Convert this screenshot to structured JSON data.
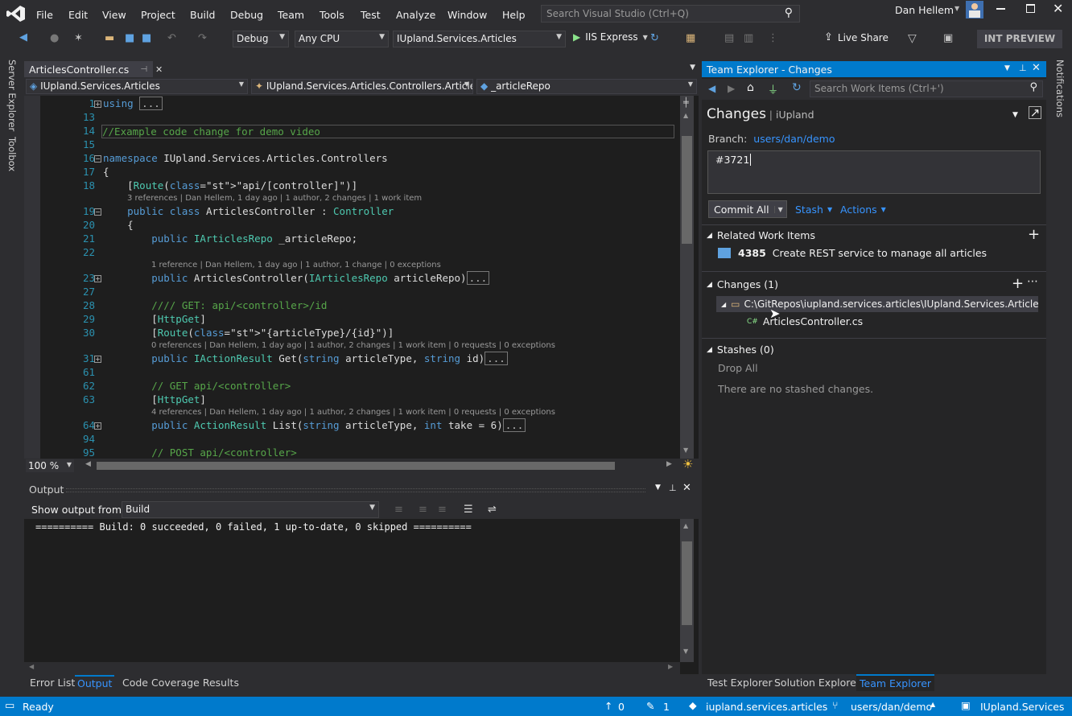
{
  "menu": [
    "File",
    "Edit",
    "View",
    "Project",
    "Build",
    "Debug",
    "Team",
    "Tools",
    "Test",
    "Analyze",
    "Window",
    "Help"
  ],
  "quick_launch": {
    "placeholder": "Search Visual Studio (Ctrl+Q)"
  },
  "user": {
    "name": "Dan Hellem"
  },
  "toolbar": {
    "config": "Debug",
    "platform": "Any CPU",
    "startup_project": "IUpland.Services.Articles",
    "run_target": "IIS Express",
    "live_share": "Live Share",
    "preview_badge": "INT PREVIEW"
  },
  "side_left": [
    "Server Explorer",
    "Toolbox"
  ],
  "side_right": [
    "Notifications"
  ],
  "editor": {
    "tab": "ArticlesController.cs",
    "nav": {
      "project": "IUpland.Services.Articles",
      "class": "IUpland.Services.Articles.Controllers.Article",
      "member": "_articleRepo"
    },
    "zoom": "100 %",
    "lines": [
      {
        "n": "1",
        "text": "using ",
        "collapsed": "..."
      },
      {
        "n": "13",
        "text": ""
      },
      {
        "n": "14",
        "text": "//Example code change for demo video"
      },
      {
        "n": "15",
        "text": ""
      },
      {
        "n": "16",
        "text": "namespace IUpland.Services.Articles.Controllers"
      },
      {
        "n": "17",
        "text": "{"
      },
      {
        "n": "18",
        "text": "    [Route(\"api/[controller]\")]"
      },
      {
        "n": "19",
        "text": "    public class ArticlesController : Controller",
        "lens": "3 references | Dan Hellem, 1 day ago | 1 author, 2 changes | 1 work item"
      },
      {
        "n": "20",
        "text": "    {"
      },
      {
        "n": "21",
        "text": "        public IArticlesRepo _articleRepo;"
      },
      {
        "n": "22",
        "text": ""
      },
      {
        "n": "23",
        "text": "        public ArticlesController(IArticlesRepo articleRepo)",
        "collapsed": "...",
        "lens": "1 reference | Dan Hellem, 1 day ago | 1 author, 1 change | 0 exceptions"
      },
      {
        "n": "27",
        "text": ""
      },
      {
        "n": "28",
        "text": "        //// GET: api/<controller>/id"
      },
      {
        "n": "29",
        "text": "        [HttpGet]"
      },
      {
        "n": "30",
        "text": "        [Route(\"{articleType}/{id}\")]"
      },
      {
        "n": "31",
        "text": "        public IActionResult Get(string articleType, string id)",
        "collapsed": "...",
        "lens": "0 references | Dan Hellem, 1 day ago | 1 author, 2 changes | 1 work item | 0 requests | 0 exceptions"
      },
      {
        "n": "61",
        "text": ""
      },
      {
        "n": "62",
        "text": "        // GET api/<controller>"
      },
      {
        "n": "63",
        "text": "        [HttpGet]"
      },
      {
        "n": "64",
        "text": "        public ActionResult List(string articleType, int take = 6)",
        "collapsed": "...",
        "lens": "4 references | Dan Hellem, 1 day ago | 1 author, 2 changes | 1 work item | 0 requests | 0 exceptions"
      },
      {
        "n": "94",
        "text": ""
      },
      {
        "n": "95",
        "text": "        // POST api/<controller>"
      }
    ]
  },
  "output": {
    "title": "Output",
    "show_from_label": "Show output from:",
    "source": "Build",
    "text": "========== Build: 0 succeeded, 0 failed, 1 up-to-date, 0 skipped =========="
  },
  "bottom_tabs": [
    "Error List",
    "Output",
    "Code Coverage Results"
  ],
  "team_explorer": {
    "title": "Team Explorer - Changes",
    "search_placeholder": "Search Work Items (Ctrl+')",
    "page": "Changes",
    "repo": "iUpland",
    "branch_label": "Branch:",
    "branch": "users/dan/demo",
    "commit_message": "#3721",
    "commit_button": "Commit All",
    "stash": "Stash",
    "actions": "Actions",
    "related_title": "Related Work Items",
    "work_item": {
      "id": "4385",
      "title": "Create REST service to manage all articles"
    },
    "changes_title": "Changes (1)",
    "folder": "C:\\GitRepos\\iupland.services.articles\\IUpland.Services.Articles\\...",
    "file": "ArticlesController.cs",
    "stashes_title": "Stashes (0)",
    "drop_all": "Drop All",
    "no_stash": "There are no stashed changes.",
    "tabs": [
      "Test Explorer",
      "Solution Explorer",
      "Team Explorer"
    ]
  },
  "status": {
    "ready": "Ready",
    "up": "0",
    "pending": "1",
    "repo": "iupland.services.articles",
    "branch": "users/dan/demo",
    "solution": "IUpland.Services"
  }
}
